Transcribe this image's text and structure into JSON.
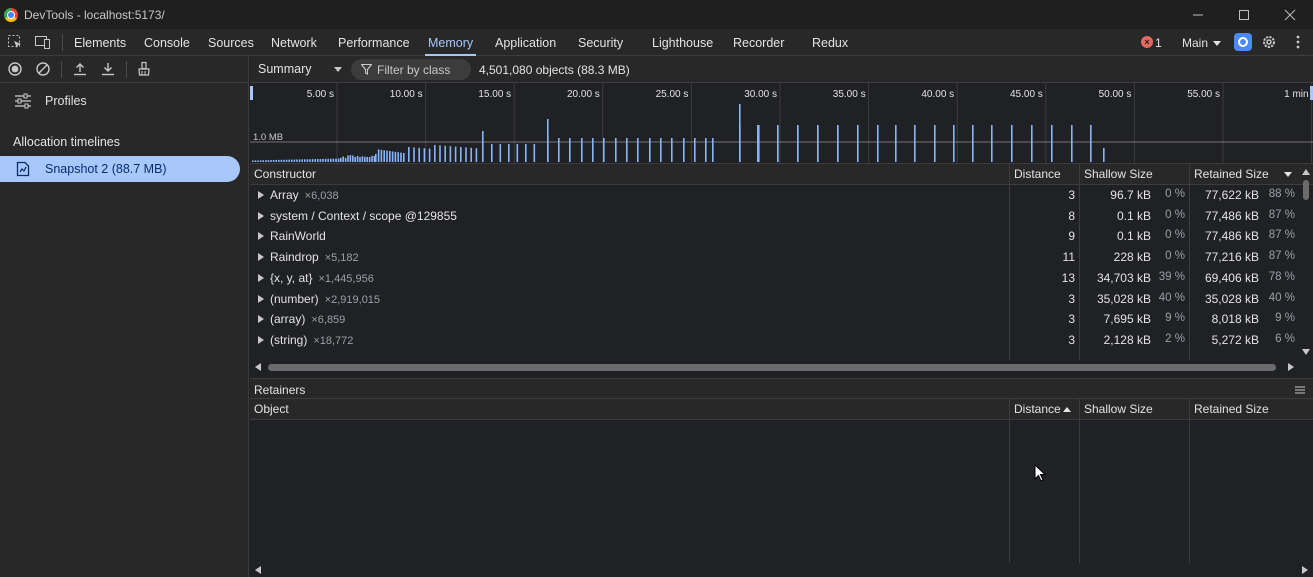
{
  "window": {
    "title": "DevTools - localhost:5173/"
  },
  "tabs": [
    {
      "label": "Elements"
    },
    {
      "label": "Console"
    },
    {
      "label": "Sources"
    },
    {
      "label": "Network"
    },
    {
      "label": "Performance"
    },
    {
      "label": "Memory",
      "active": true
    },
    {
      "label": "Application"
    },
    {
      "label": "Security"
    },
    {
      "label": "Lighthouse"
    },
    {
      "label": "Recorder"
    },
    {
      "label": "Redux"
    }
  ],
  "status": {
    "error_count": "1",
    "context": "Main"
  },
  "sidebar": {
    "profiles_label": "Profiles",
    "section_label": "Allocation timelines",
    "snapshot_label": "Snapshot 2 (88.7 MB)"
  },
  "toolbar": {
    "view": "Summary",
    "filter_placeholder": "Filter by class",
    "object_count": "4,501,080 objects (88.3 MB)"
  },
  "timeline": {
    "size_label": "1.0 MB",
    "ticks": [
      "5.00 s",
      "10.00 s",
      "15.00 s",
      "20.00 s",
      "25.00 s",
      "30.00 s",
      "35.00 s",
      "40.00 s",
      "45.00 s",
      "50.00 s",
      "55.00 s",
      "1 min"
    ]
  },
  "grid": {
    "columns": {
      "constructor": "Constructor",
      "distance": "Distance",
      "shallow": "Shallow Size",
      "retained": "Retained Size"
    },
    "rows": [
      {
        "name": "Array",
        "count": "×6,038",
        "distance": "3",
        "shallow": "96.7 kB",
        "shallow_pct": "0 %",
        "retained": "77,622 kB",
        "retained_pct": "88 %"
      },
      {
        "name": "system / Context / scope @129855",
        "count": "",
        "distance": "8",
        "shallow": "0.1 kB",
        "shallow_pct": "0 %",
        "retained": "77,486 kB",
        "retained_pct": "87 %"
      },
      {
        "name": "RainWorld",
        "count": "",
        "distance": "9",
        "shallow": "0.1 kB",
        "shallow_pct": "0 %",
        "retained": "77,486 kB",
        "retained_pct": "87 %"
      },
      {
        "name": "Raindrop",
        "count": "×5,182",
        "distance": "11",
        "shallow": "228 kB",
        "shallow_pct": "0 %",
        "retained": "77,216 kB",
        "retained_pct": "87 %"
      },
      {
        "name": "{x, y, at}",
        "count": "×1,445,956",
        "distance": "13",
        "shallow": "34,703 kB",
        "shallow_pct": "39 %",
        "retained": "69,406 kB",
        "retained_pct": "78 %"
      },
      {
        "name": "(number)",
        "count": "×2,919,015",
        "distance": "3",
        "shallow": "35,028 kB",
        "shallow_pct": "40 %",
        "retained": "35,028 kB",
        "retained_pct": "40 %"
      },
      {
        "name": "(array)",
        "count": "×6,859",
        "distance": "3",
        "shallow": "7,695 kB",
        "shallow_pct": "9 %",
        "retained": "8,018 kB",
        "retained_pct": "9 %"
      },
      {
        "name": "(string)",
        "count": "×18,772",
        "distance": "3",
        "shallow": "2,128 kB",
        "shallow_pct": "2 %",
        "retained": "5,272 kB",
        "retained_pct": "6 %"
      }
    ]
  },
  "retainers": {
    "title": "Retainers",
    "columns": {
      "object": "Object",
      "distance": "Distance",
      "shallow": "Shallow Size",
      "retained": "Retained Size"
    }
  }
}
